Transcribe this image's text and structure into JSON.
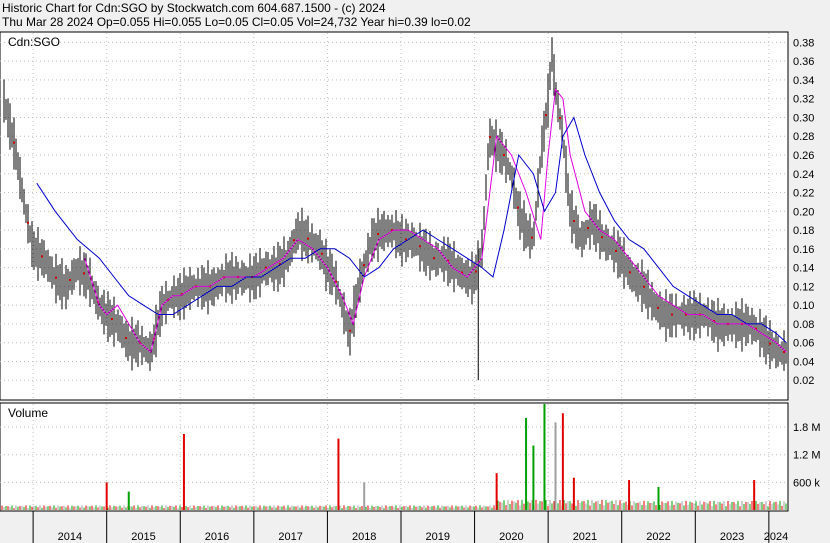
{
  "header": {
    "line1": "Historic Chart for Cdn:SGO by Stockwatch.com 604.687.1500 - (c) 2024",
    "line2": "Thu Mar 28 2024  Op=0.055  Hi=0.055  Lo=0.05  Cl=0.05  Vol=24,732  Year hi=0.39  lo=0.02"
  },
  "colors": {
    "background": "#f0f0f0",
    "plot_bg": "#ffffff",
    "grid": "#c0c0c0",
    "price_bars": "#000000",
    "ma_short": "#e000e0",
    "ma_long": "#0000cc",
    "vol_up": "#00a000",
    "vol_down": "#e00000",
    "vol_flat": "#a0a0a0"
  },
  "chart_data": [
    {
      "type": "line",
      "title": "Cdn:SGO",
      "ylim": [
        0.0,
        0.39
      ],
      "y_ticks": [
        "0.02",
        "0.04",
        "0.06",
        "0.08",
        "0.10",
        "0.12",
        "0.14",
        "0.16",
        "0.18",
        "0.20",
        "0.22",
        "0.24",
        "0.26",
        "0.28",
        "0.30",
        "0.32",
        "0.34",
        "0.36",
        "0.38"
      ],
      "x_ticks": [
        "2014",
        "2015",
        "2016",
        "2017",
        "2018",
        "2019",
        "2020",
        "2021",
        "2022",
        "2023",
        "2024"
      ],
      "grid": true,
      "series": [
        {
          "role": "price_bars",
          "x": [
            2013.6,
            2013.75,
            2013.9,
            2014.0,
            2014.15,
            2014.3,
            2014.45,
            2014.6,
            2014.75,
            2014.9,
            2015.0,
            2015.15,
            2015.3,
            2015.45,
            2015.6,
            2015.75,
            2015.9,
            2016.0,
            2016.15,
            2016.3,
            2016.45,
            2016.6,
            2016.75,
            2016.9,
            2017.0,
            2017.15,
            2017.3,
            2017.45,
            2017.6,
            2017.75,
            2017.9,
            2018.0,
            2018.1,
            2018.2,
            2018.3,
            2018.45,
            2018.6,
            2018.75,
            2018.9,
            2019.0,
            2019.15,
            2019.3,
            2019.45,
            2019.6,
            2019.75,
            2019.9,
            2020.0,
            2020.1,
            2020.2,
            2020.3,
            2020.4,
            2020.5,
            2020.6,
            2020.7,
            2020.8,
            2020.9,
            2021.0,
            2021.05,
            2021.1,
            2021.2,
            2021.3,
            2021.45,
            2021.6,
            2021.75,
            2021.9,
            2022.0,
            2022.15,
            2022.3,
            2022.45,
            2022.6,
            2022.75,
            2022.9,
            2023.0,
            2023.15,
            2023.3,
            2023.45,
            2023.6,
            2023.75,
            2023.9,
            2024.0,
            2024.15,
            2024.24
          ],
          "values": [
            0.32,
            0.27,
            0.2,
            0.16,
            0.15,
            0.13,
            0.12,
            0.14,
            0.13,
            0.1,
            0.09,
            0.08,
            0.06,
            0.06,
            0.05,
            0.1,
            0.11,
            0.11,
            0.12,
            0.12,
            0.12,
            0.13,
            0.13,
            0.13,
            0.13,
            0.14,
            0.14,
            0.15,
            0.18,
            0.17,
            0.16,
            0.14,
            0.13,
            0.1,
            0.07,
            0.13,
            0.17,
            0.18,
            0.18,
            0.17,
            0.17,
            0.16,
            0.15,
            0.15,
            0.14,
            0.13,
            0.13,
            0.16,
            0.28,
            0.27,
            0.26,
            0.24,
            0.2,
            0.18,
            0.17,
            0.26,
            0.32,
            0.37,
            0.33,
            0.28,
            0.2,
            0.17,
            0.19,
            0.17,
            0.16,
            0.15,
            0.13,
            0.12,
            0.1,
            0.09,
            0.09,
            0.09,
            0.09,
            0.09,
            0.08,
            0.08,
            0.08,
            0.08,
            0.07,
            0.06,
            0.05,
            0.05
          ]
        },
        {
          "role": "ma_short",
          "x": [
            2014.7,
            2014.9,
            2015.0,
            2015.15,
            2015.3,
            2015.45,
            2015.6,
            2015.75,
            2015.9,
            2016.0,
            2016.2,
            2016.4,
            2016.6,
            2016.8,
            2017.0,
            2017.2,
            2017.4,
            2017.6,
            2017.8,
            2018.0,
            2018.2,
            2018.35,
            2018.5,
            2018.7,
            2018.9,
            2019.1,
            2019.3,
            2019.5,
            2019.7,
            2019.9,
            2020.1,
            2020.3,
            2020.5,
            2020.7,
            2020.9,
            2021.0,
            2021.1,
            2021.2,
            2021.3,
            2021.5,
            2021.7,
            2021.9,
            2022.1,
            2022.3,
            2022.5,
            2022.7,
            2022.9,
            2023.1,
            2023.3,
            2023.5,
            2023.7,
            2023.9,
            2024.1,
            2024.24
          ],
          "values": [
            0.15,
            0.1,
            0.09,
            0.1,
            0.08,
            0.06,
            0.05,
            0.1,
            0.11,
            0.11,
            0.12,
            0.12,
            0.13,
            0.13,
            0.13,
            0.14,
            0.15,
            0.17,
            0.16,
            0.14,
            0.11,
            0.08,
            0.13,
            0.17,
            0.18,
            0.18,
            0.17,
            0.16,
            0.14,
            0.13,
            0.15,
            0.28,
            0.26,
            0.22,
            0.17,
            0.26,
            0.33,
            0.32,
            0.26,
            0.2,
            0.18,
            0.17,
            0.15,
            0.13,
            0.11,
            0.1,
            0.09,
            0.09,
            0.08,
            0.08,
            0.08,
            0.07,
            0.06,
            0.05
          ]
        },
        {
          "role": "ma_long",
          "x": [
            2014.05,
            2014.3,
            2014.6,
            2014.9,
            2015.1,
            2015.3,
            2015.5,
            2015.7,
            2015.9,
            2016.1,
            2016.3,
            2016.5,
            2016.7,
            2016.9,
            2017.1,
            2017.3,
            2017.5,
            2017.7,
            2017.9,
            2018.1,
            2018.3,
            2018.5,
            2018.7,
            2018.9,
            2019.1,
            2019.3,
            2019.5,
            2019.7,
            2019.9,
            2020.1,
            2020.25,
            2020.4,
            2020.6,
            2020.8,
            2020.95,
            2021.1,
            2021.2,
            2021.35,
            2021.5,
            2021.7,
            2021.9,
            2022.1,
            2022.3,
            2022.5,
            2022.7,
            2022.9,
            2023.1,
            2023.3,
            2023.5,
            2023.7,
            2023.9,
            2024.1,
            2024.24
          ],
          "values": [
            0.23,
            0.2,
            0.17,
            0.15,
            0.13,
            0.11,
            0.1,
            0.09,
            0.09,
            0.1,
            0.11,
            0.12,
            0.12,
            0.13,
            0.13,
            0.14,
            0.15,
            0.15,
            0.16,
            0.16,
            0.15,
            0.13,
            0.14,
            0.16,
            0.17,
            0.18,
            0.17,
            0.16,
            0.15,
            0.14,
            0.13,
            0.18,
            0.26,
            0.24,
            0.2,
            0.22,
            0.28,
            0.3,
            0.26,
            0.22,
            0.19,
            0.17,
            0.16,
            0.14,
            0.12,
            0.11,
            0.1,
            0.09,
            0.09,
            0.08,
            0.08,
            0.07,
            0.06
          ]
        }
      ]
    },
    {
      "type": "bar",
      "title": "Volume",
      "y_ticks": [
        "600 k",
        "1.2 M",
        "1.8 M"
      ],
      "ylim": [
        0,
        2300000
      ],
      "spikes": [
        {
          "x": 2015.0,
          "value": 600000,
          "dir": "down"
        },
        {
          "x": 2015.3,
          "value": 400000,
          "dir": "up"
        },
        {
          "x": 2016.05,
          "value": 1650000,
          "dir": "down"
        },
        {
          "x": 2018.15,
          "value": 1550000,
          "dir": "down"
        },
        {
          "x": 2018.5,
          "value": 600000,
          "dir": "flat"
        },
        {
          "x": 2020.3,
          "value": 800000,
          "dir": "down"
        },
        {
          "x": 2020.7,
          "value": 2000000,
          "dir": "up"
        },
        {
          "x": 2020.8,
          "value": 1400000,
          "dir": "up"
        },
        {
          "x": 2020.95,
          "value": 2300000,
          "dir": "up"
        },
        {
          "x": 2021.1,
          "value": 1900000,
          "dir": "flat"
        },
        {
          "x": 2021.2,
          "value": 2100000,
          "dir": "down"
        },
        {
          "x": 2021.35,
          "value": 700000,
          "dir": "down"
        },
        {
          "x": 2022.1,
          "value": 650000,
          "dir": "down"
        },
        {
          "x": 2022.5,
          "value": 500000,
          "dir": "up"
        },
        {
          "x": 2023.8,
          "value": 650000,
          "dir": "down"
        }
      ]
    }
  ]
}
